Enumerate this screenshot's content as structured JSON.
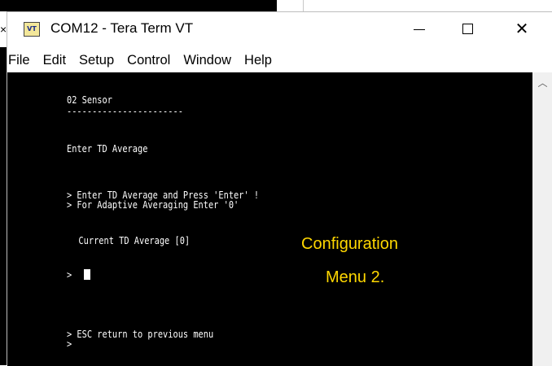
{
  "window": {
    "title": "COM12 - Tera Term VT",
    "icon_label": "VT",
    "controls": {
      "minimize_icon": "minimize-icon",
      "maximize_icon": "maximize-icon",
      "close_icon": "close-icon"
    }
  },
  "background": {
    "close_glyph": "×"
  },
  "menubar": {
    "items": [
      "File",
      "Edit",
      "Setup",
      "Control",
      "Window",
      "Help"
    ]
  },
  "terminal": {
    "lines": [
      "02 Sensor",
      "-----------------------",
      "Enter TD Average",
      "> Enter TD Average and Press 'Enter' !",
      "> For Adaptive Averaging Enter '0'",
      "  Current TD Average [0]",
      "> ",
      "> ESC return to previous menu",
      ">"
    ]
  },
  "overlay": {
    "line1": "Configuration",
    "line2": "Menu 2."
  },
  "colors": {
    "terminal_bg": "#000000",
    "terminal_fg": "#ffffff",
    "overlay_text": "#ffd700"
  }
}
